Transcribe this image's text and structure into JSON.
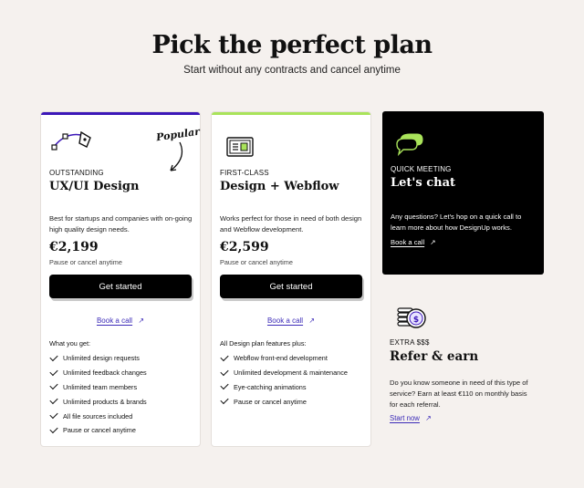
{
  "header": {
    "title": "Pick the perfect plan",
    "subtitle": "Start without any contracts and cancel anytime"
  },
  "colors": {
    "page_bg": "#f5f1ee",
    "plan1_accent": "#3c17b8",
    "plan2_accent": "#a9e35a",
    "link": "#3c2bb8",
    "dark_card_bg": "#000000"
  },
  "plans": [
    {
      "badge": "Popular",
      "eyebrow": "OUTSTANDING",
      "name": "UX/UI Design",
      "description": "Best for startups and companies with on-going high quality design needs.",
      "price": "€2,199",
      "pause_note": "Pause or cancel anytime",
      "cta": "Get started",
      "book_call": "Book a call",
      "features_title": "What you get:",
      "features": [
        "Unlimited design requests",
        "Unlimited feedback changes",
        "Unlimited team members",
        "Unlimited products & brands",
        "All file sources included",
        "Pause or cancel anytime"
      ]
    },
    {
      "eyebrow": "FIRST-CLASS",
      "name": "Design + Webflow",
      "description": "Works perfect for those in need of both design and Webflow development.",
      "price": "€2,599",
      "pause_note": "Pause or cancel anytime",
      "cta": "Get started",
      "book_call": "Book a call",
      "features_title": "All Design plan features plus:",
      "features": [
        "Webflow front-end development",
        "Unlimited development & maintenance",
        "Eye-catching animations",
        "Pause or cancel anytime"
      ]
    }
  ],
  "quick_meeting": {
    "eyebrow": "QUICK MEETING",
    "title": "Let's chat",
    "description": "Any questions? Let's hop on a quick call to learn more about how DesignUp works.",
    "link": "Book a call"
  },
  "referral": {
    "eyebrow": "EXTRA $$$",
    "title": "Refer & earn",
    "description": "Do you know someone in need of this type of service? Earn at least €110 on monthly basis for each referral.",
    "link": "Start now"
  },
  "icons": {
    "plan1": "pen-tool-icon",
    "plan2": "browser-window-icon",
    "chat": "chat-bubbles-icon",
    "refer": "coins-icon",
    "arrow": "arrow-up-right-icon"
  }
}
